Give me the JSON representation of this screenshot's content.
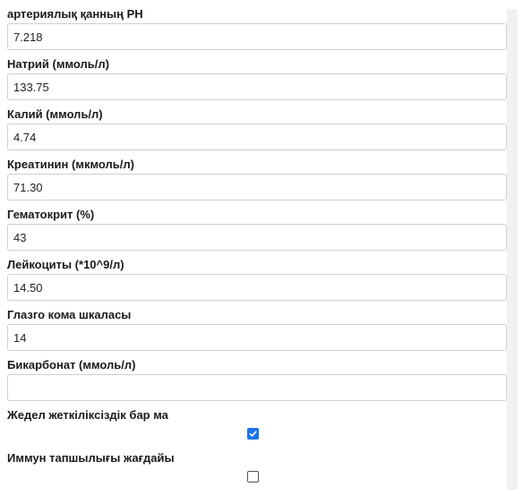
{
  "fields": [
    {
      "label": "артериялық қанның PH",
      "value": "7.218"
    },
    {
      "label": "Натрий (ммоль/л)",
      "value": "133.75"
    },
    {
      "label": "Калий (ммоль/л)",
      "value": "4.74"
    },
    {
      "label": "Креатинин (мкмоль/л)",
      "value": "71.30"
    },
    {
      "label": "Гематокрит (%)",
      "value": "43"
    },
    {
      "label": "Лейкоциты (*10^9/л)",
      "value": "14.50"
    },
    {
      "label": "Глазго кома шкаласы",
      "value": "14"
    },
    {
      "label": "Бикарбонат (ммоль/л)",
      "value": ""
    }
  ],
  "checkboxes": [
    {
      "label": "Жедел жеткіліксіздік бар ма",
      "checked": true
    },
    {
      "label": "Иммун тапшылығы жағдайы",
      "checked": false
    }
  ],
  "colors": {
    "checkbox_checked": "#1a73e8",
    "input_border": "#cfcfcf",
    "scrollbar_track": "#f1f1f1"
  }
}
